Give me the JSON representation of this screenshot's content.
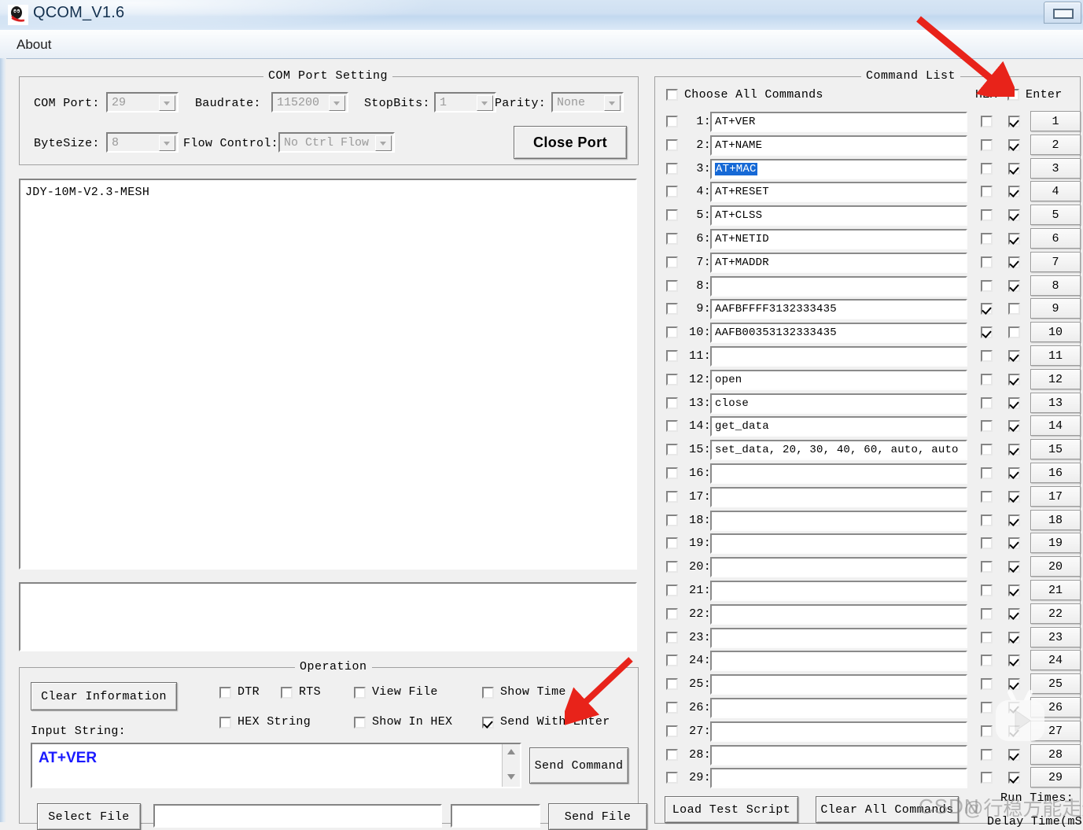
{
  "window": {
    "title": "QCOM_V1.6",
    "icon": "qq-penguin-icon",
    "minimize_label": "",
    "menu": {
      "about": "About"
    }
  },
  "com_port_setting": {
    "group_title": "COM Port Setting",
    "fields": [
      {
        "label": "COM Port:",
        "value": "29"
      },
      {
        "label": "Baudrate:",
        "value": "115200"
      },
      {
        "label": "StopBits:",
        "value": "1"
      },
      {
        "label": "Parity:",
        "value": "None"
      },
      {
        "label": "ByteSize:",
        "value": "8"
      },
      {
        "label": "Flow Control:",
        "value": "No Ctrl Flow"
      }
    ],
    "close_port_button": "Close Port"
  },
  "terminal": {
    "output": "JDY-10M-V2.3-MESH"
  },
  "operation": {
    "group_title": "Operation",
    "clear_information_button": "Clear Information",
    "checkboxes": [
      {
        "label": "DTR",
        "checked": false
      },
      {
        "label": "RTS",
        "checked": false
      },
      {
        "label": "View File",
        "checked": false
      },
      {
        "label": "Show Time",
        "checked": false
      },
      {
        "label": "HEX String",
        "checked": false
      },
      {
        "label": "Show In HEX",
        "checked": false
      },
      {
        "label": "Send With Enter",
        "checked": true
      }
    ],
    "input_string_label": "Input String:",
    "input_string_value": "AT+VER",
    "input_string_color": "#1a1aff",
    "send_command_button": "Send Command",
    "select_file_button": "Select File",
    "select_file_path": "",
    "send_file_button": "Send File"
  },
  "command_list": {
    "group_title": "Command List",
    "choose_all_label": "Choose All Commands",
    "choose_all_checked": false,
    "hex_header": "HEX",
    "enter_header": "Enter",
    "enter_header_checked": false,
    "rows": [
      {
        "n": "1:",
        "text": "AT+VER",
        "sel": false,
        "hex": false,
        "enter": true,
        "btn": "1"
      },
      {
        "n": "2:",
        "text": "AT+NAME",
        "sel": false,
        "hex": false,
        "enter": true,
        "btn": "2"
      },
      {
        "n": "3:",
        "text": "AT+MAC",
        "sel": true,
        "hex": false,
        "enter": true,
        "btn": "3"
      },
      {
        "n": "4:",
        "text": "AT+RESET",
        "sel": false,
        "hex": false,
        "enter": true,
        "btn": "4"
      },
      {
        "n": "5:",
        "text": "AT+CLSS",
        "sel": false,
        "hex": false,
        "enter": true,
        "btn": "5"
      },
      {
        "n": "6:",
        "text": "AT+NETID",
        "sel": false,
        "hex": false,
        "enter": true,
        "btn": "6"
      },
      {
        "n": "7:",
        "text": "AT+MADDR",
        "sel": false,
        "hex": false,
        "enter": true,
        "btn": "7"
      },
      {
        "n": "8:",
        "text": "",
        "sel": false,
        "hex": false,
        "enter": true,
        "btn": "8"
      },
      {
        "n": "9:",
        "text": "AAFBFFFF3132333435",
        "sel": false,
        "hex": true,
        "enter": false,
        "btn": "9"
      },
      {
        "n": "10:",
        "text": "AAFB00353132333435",
        "sel": false,
        "hex": true,
        "enter": false,
        "btn": "10"
      },
      {
        "n": "11:",
        "text": "",
        "sel": false,
        "hex": false,
        "enter": true,
        "btn": "11"
      },
      {
        "n": "12:",
        "text": "open",
        "sel": false,
        "hex": false,
        "enter": true,
        "btn": "12"
      },
      {
        "n": "13:",
        "text": "close",
        "sel": false,
        "hex": false,
        "enter": true,
        "btn": "13"
      },
      {
        "n": "14:",
        "text": "get_data",
        "sel": false,
        "hex": false,
        "enter": true,
        "btn": "14"
      },
      {
        "n": "15:",
        "text": "set_data, 20, 30, 40, 60, auto, auto",
        "sel": false,
        "hex": false,
        "enter": true,
        "btn": "15"
      },
      {
        "n": "16:",
        "text": "",
        "sel": false,
        "hex": false,
        "enter": true,
        "btn": "16"
      },
      {
        "n": "17:",
        "text": "",
        "sel": false,
        "hex": false,
        "enter": true,
        "btn": "17"
      },
      {
        "n": "18:",
        "text": "",
        "sel": false,
        "hex": false,
        "enter": true,
        "btn": "18"
      },
      {
        "n": "19:",
        "text": "",
        "sel": false,
        "hex": false,
        "enter": true,
        "btn": "19"
      },
      {
        "n": "20:",
        "text": "",
        "sel": false,
        "hex": false,
        "enter": true,
        "btn": "20"
      },
      {
        "n": "21:",
        "text": "",
        "sel": false,
        "hex": false,
        "enter": true,
        "btn": "21"
      },
      {
        "n": "22:",
        "text": "",
        "sel": false,
        "hex": false,
        "enter": true,
        "btn": "22"
      },
      {
        "n": "23:",
        "text": "",
        "sel": false,
        "hex": false,
        "enter": true,
        "btn": "23"
      },
      {
        "n": "24:",
        "text": "",
        "sel": false,
        "hex": false,
        "enter": true,
        "btn": "24"
      },
      {
        "n": "25:",
        "text": "",
        "sel": false,
        "hex": false,
        "enter": true,
        "btn": "25"
      },
      {
        "n": "26:",
        "text": "",
        "sel": false,
        "hex": false,
        "enter": true,
        "btn": "26"
      },
      {
        "n": "27:",
        "text": "",
        "sel": false,
        "hex": false,
        "enter": true,
        "btn": "27"
      },
      {
        "n": "28:",
        "text": "",
        "sel": false,
        "hex": false,
        "enter": true,
        "btn": "28"
      },
      {
        "n": "29:",
        "text": "",
        "sel": false,
        "hex": false,
        "enter": true,
        "btn": "29"
      }
    ],
    "load_test_script_button": "Load Test Script",
    "clear_all_commands_button": "Clear All Commands",
    "run_times_label": "Run Times:",
    "delay_time_label": "Delay Time(mS):"
  },
  "watermark": {
    "site": "CSDN",
    "user": "@行稳方能走远"
  },
  "annotations": {
    "arrow_top_color": "#e8231a",
    "arrow_bottom_color": "#e8231a"
  }
}
